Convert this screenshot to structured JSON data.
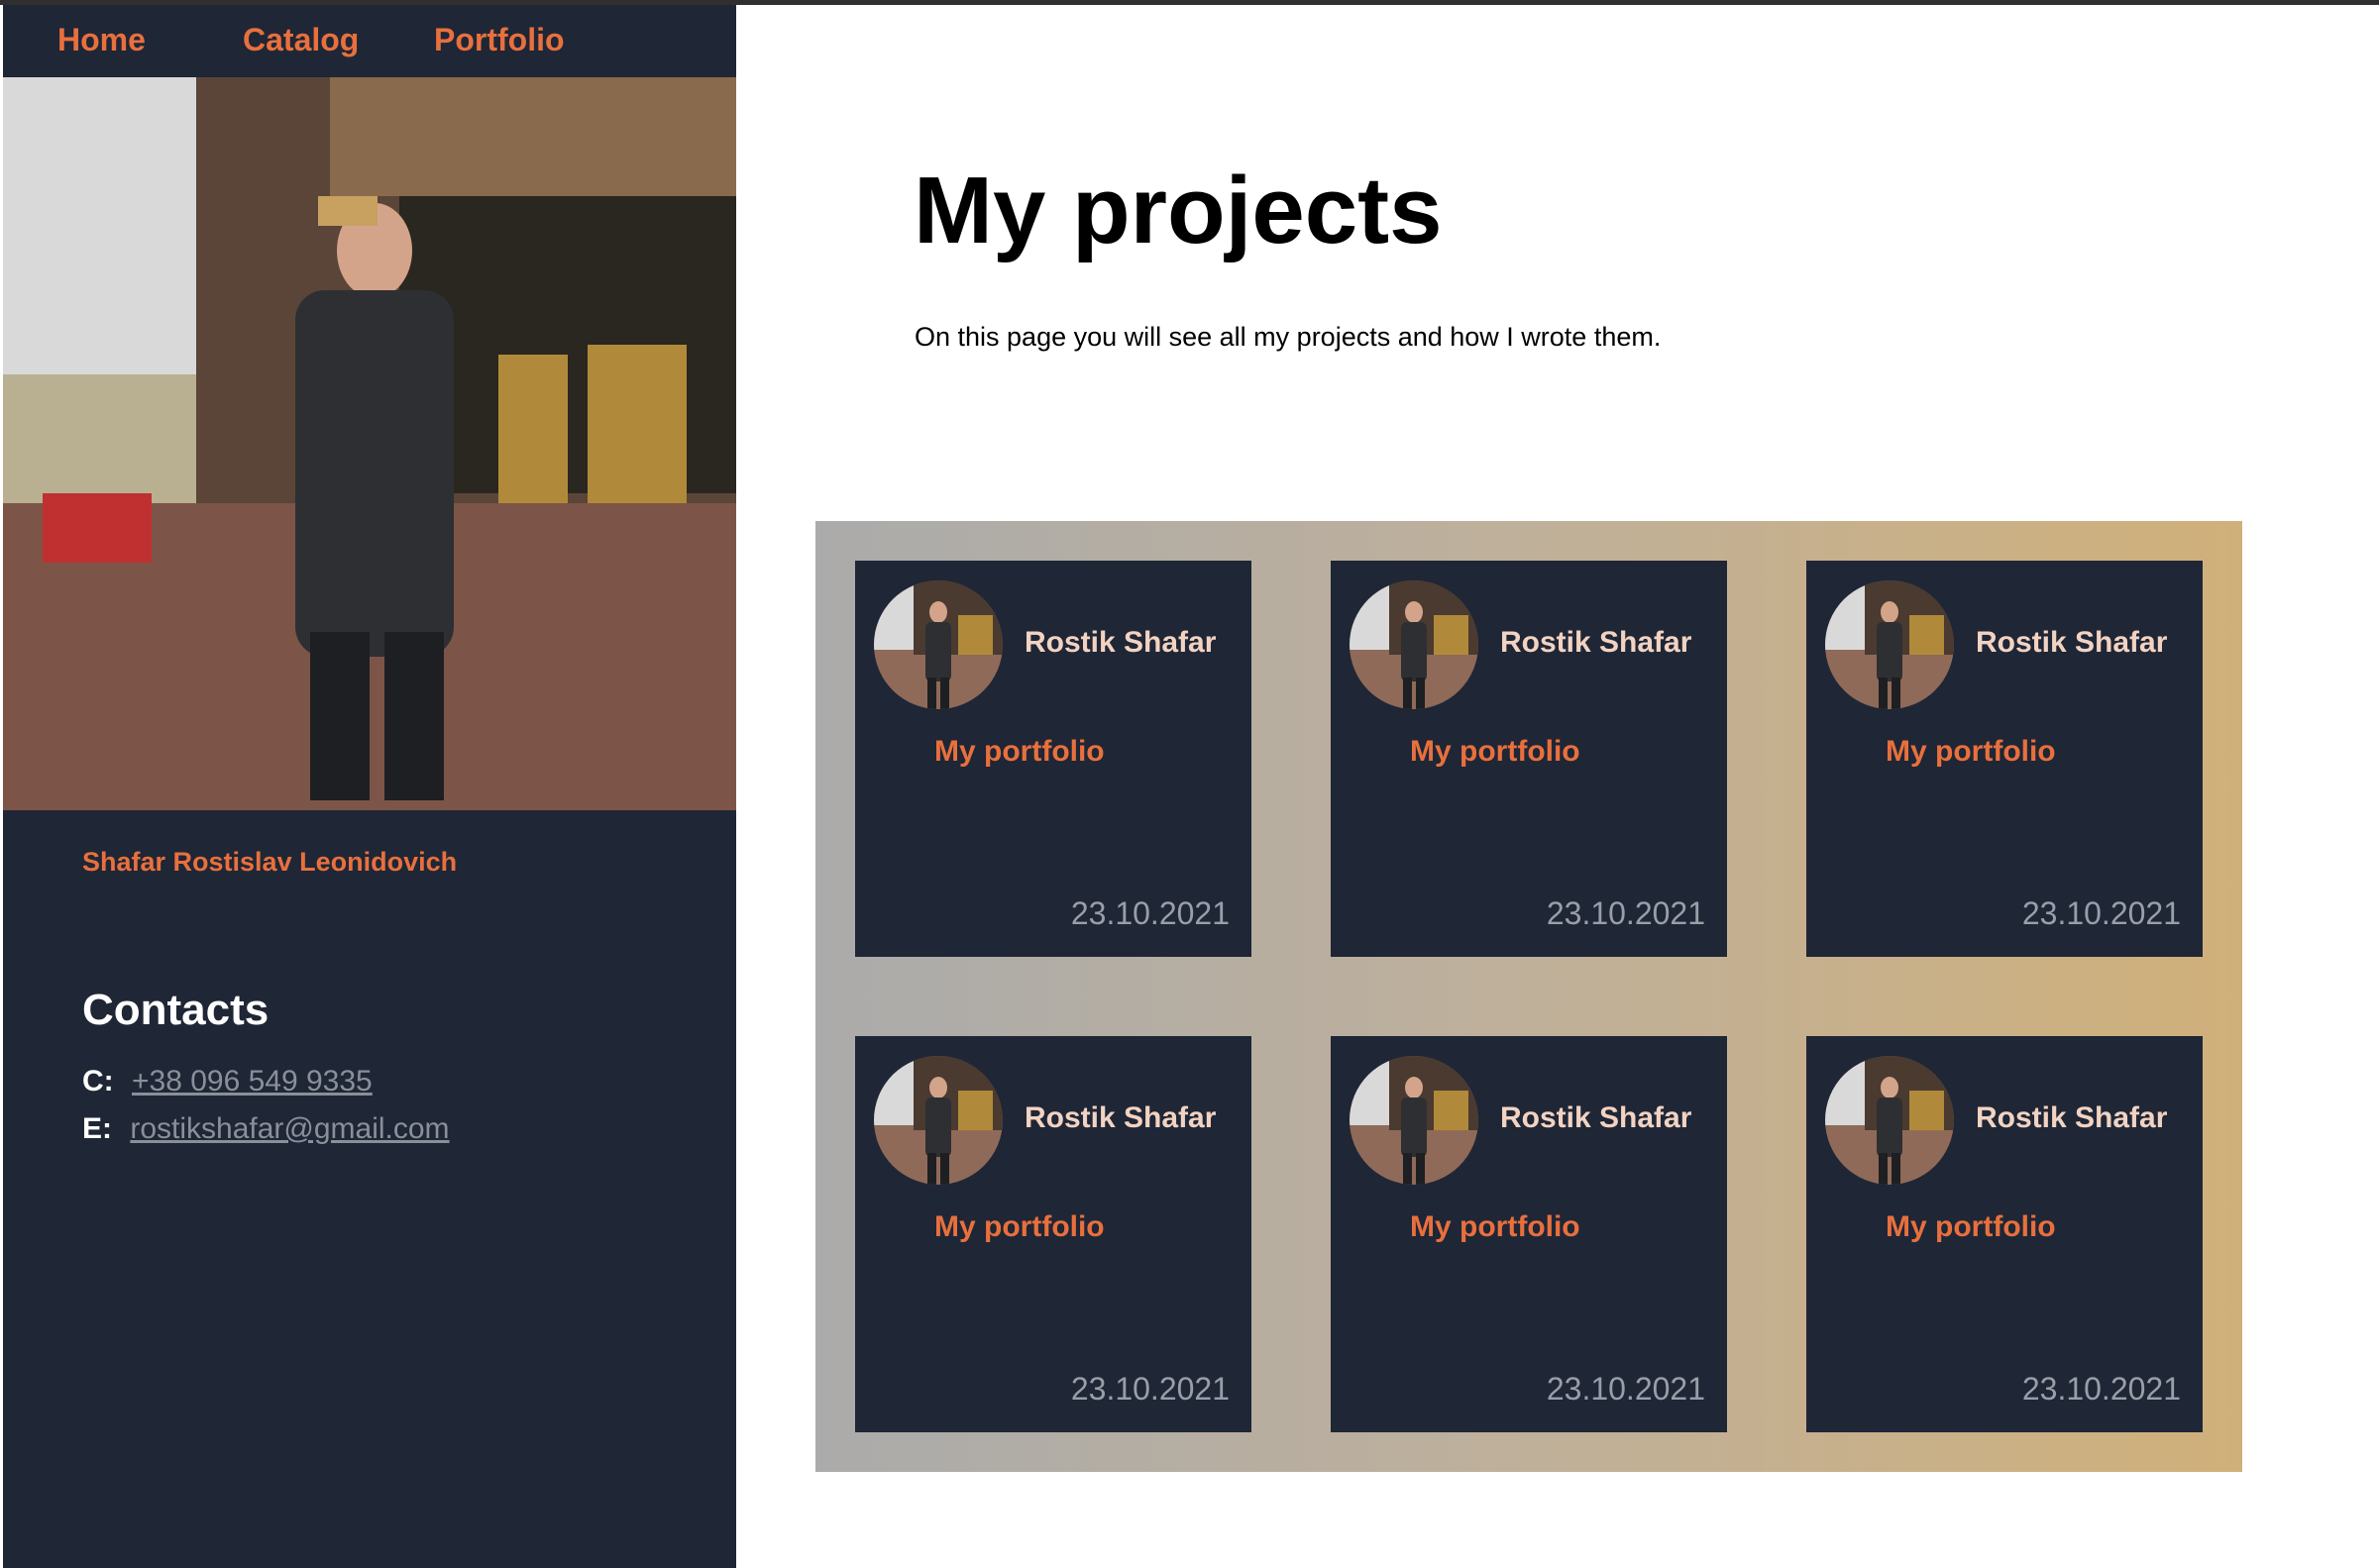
{
  "nav": {
    "home": "Home",
    "catalog": "Catalog",
    "portfolio": "Portfolio"
  },
  "profile": {
    "full_name": "Shafar Rostislav Leonidovich"
  },
  "contacts": {
    "title": "Contacts",
    "phone_key": "C:",
    "phone": "+38 096 549 9335",
    "email_key": "E:",
    "email": "rostikshafar@gmail.com"
  },
  "main": {
    "title": "My projects",
    "lead": "On this page you will see all my projects and how I wrote them."
  },
  "cards": [
    {
      "author": "Rostik Shafar",
      "title": "My portfolio",
      "date": "23.10.2021"
    },
    {
      "author": "Rostik Shafar",
      "title": "My portfolio",
      "date": "23.10.2021"
    },
    {
      "author": "Rostik Shafar",
      "title": "My portfolio",
      "date": "23.10.2021"
    },
    {
      "author": "Rostik Shafar",
      "title": "My portfolio",
      "date": "23.10.2021"
    },
    {
      "author": "Rostik Shafar",
      "title": "My portfolio",
      "date": "23.10.2021"
    },
    {
      "author": "Rostik Shafar",
      "title": "My portfolio",
      "date": "23.10.2021"
    }
  ],
  "colors": {
    "accent": "#e8703d",
    "sidebar": "#1f2636",
    "card": "#1f2636"
  }
}
